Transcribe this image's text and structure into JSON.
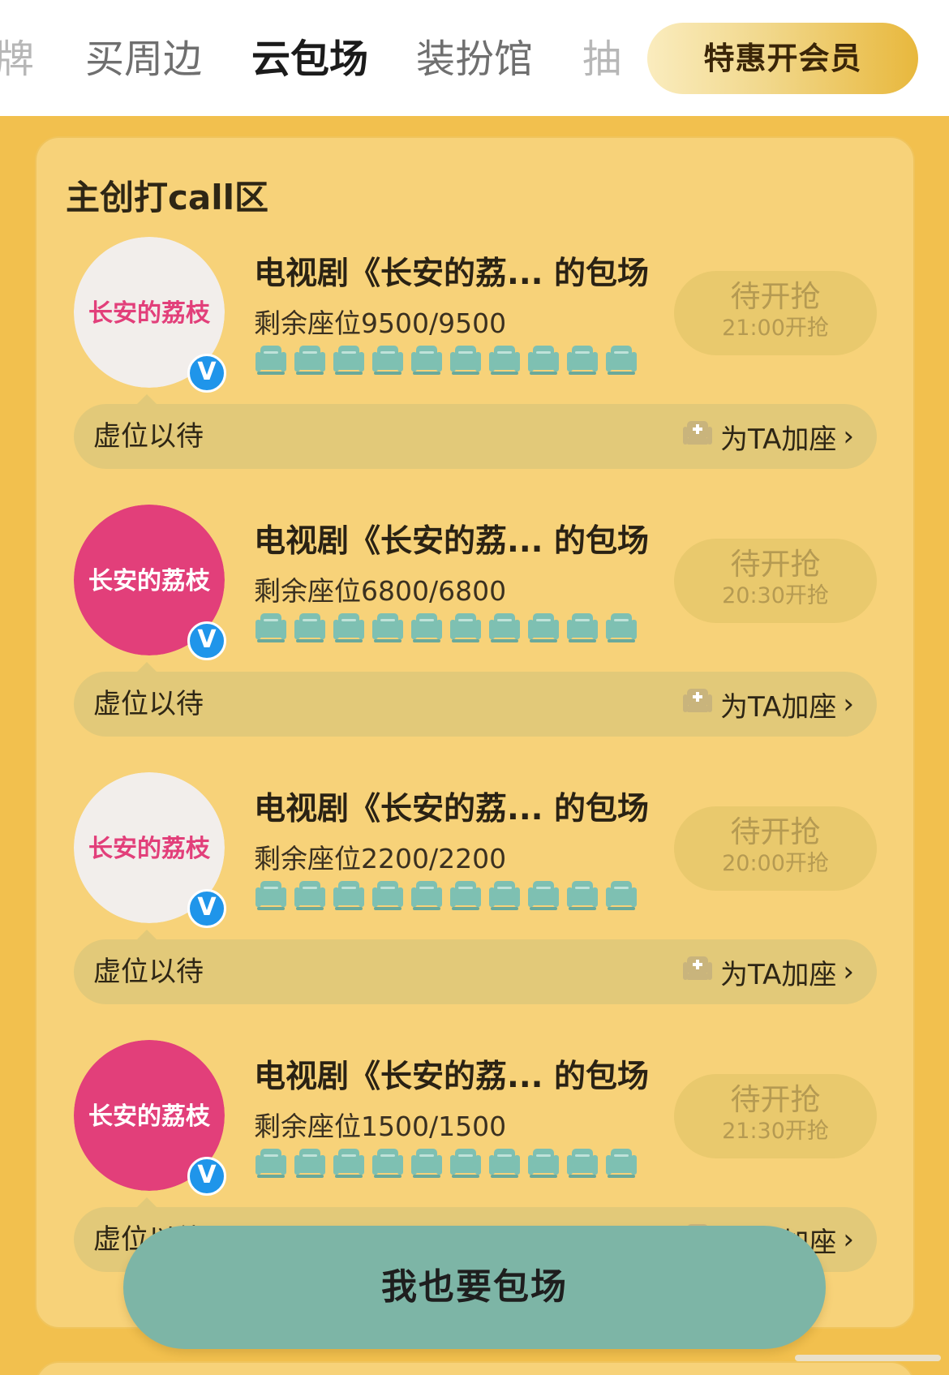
{
  "tabs": [
    {
      "label": "牌",
      "state": "partial"
    },
    {
      "label": "买周边",
      "state": "normal"
    },
    {
      "label": "云包场",
      "state": "active"
    },
    {
      "label": "装扮馆",
      "state": "normal"
    },
    {
      "label": "抽",
      "state": "partial"
    }
  ],
  "vip_button": {
    "label": "特惠开会员"
  },
  "section": {
    "title": "主创打call区"
  },
  "cards": [
    {
      "title": "电视剧《长安的荔... 的包场",
      "seats": "剩余座位9500/9500",
      "status": "待开抢",
      "time": "21:00开抢",
      "avatar_style": "light",
      "info": "虚位以待",
      "add_seat": "为TA加座"
    },
    {
      "title": "电视剧《长安的荔... 的包场",
      "seats": "剩余座位6800/6800",
      "status": "待开抢",
      "time": "20:30开抢",
      "avatar_style": "pink",
      "info": "虚位以待",
      "add_seat": "为TA加座"
    },
    {
      "title": "电视剧《长安的荔... 的包场",
      "seats": "剩余座位2200/2200",
      "status": "待开抢",
      "time": "20:00开抢",
      "avatar_style": "light",
      "info": "虚位以待",
      "add_seat": "为TA加座"
    },
    {
      "title": "电视剧《长安的荔... 的包场",
      "seats": "剩余座位1500/1500",
      "status": "待开抢",
      "time": "21:30开抢",
      "avatar_style": "pink",
      "info": "虚位以待",
      "add_seat": "为TA加座"
    }
  ],
  "avatar_logo_text": "长安的荔枝",
  "verified_badge": "V",
  "float_button": {
    "label": "我也要包场"
  },
  "colors": {
    "page_bg": "#f2c04e",
    "panel_bg": "#f7d279",
    "seat": "#7ec0b2",
    "avatar_pink": "#e23f7a",
    "avatar_light": "#f2eeeb",
    "verified": "#1f95ea",
    "float_button": "#7db5a6"
  }
}
